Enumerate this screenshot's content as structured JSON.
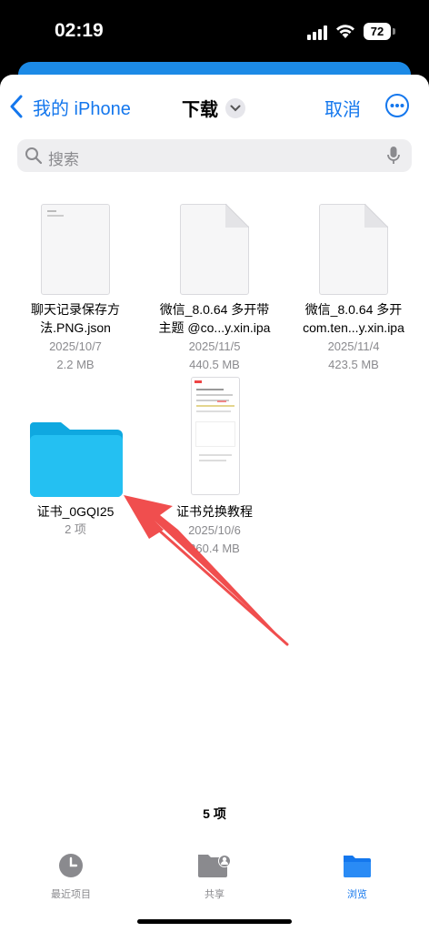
{
  "status_bar": {
    "time": "02:19",
    "battery": "72"
  },
  "nav": {
    "back_label": "我的 iPhone",
    "title": "下载",
    "cancel_label": "取消"
  },
  "search": {
    "placeholder": "搜索"
  },
  "files": [
    {
      "name_line1": "聊天记录保存方",
      "name_line2": "法.PNG.json",
      "date": "2025/10/7",
      "size": "2.2 MB"
    },
    {
      "name_line1": "微信_8.0.64 多开带",
      "name_line2": "主题 @co...y.xin.ipa",
      "date": "2025/11/5",
      "size": "440.5 MB"
    },
    {
      "name_line1": "微信_8.0.64 多开",
      "name_line2": "com.ten...y.xin.ipa",
      "date": "2025/11/4",
      "size": "423.5 MB"
    },
    {
      "name_line1": "证书_0GQI25",
      "name_line2": "",
      "date": "",
      "size": "2 项"
    },
    {
      "name_line1": "证书兑换教程",
      "name_line2": "",
      "date": "2025/10/6",
      "size": "360.4 MB"
    }
  ],
  "footer": {
    "count": "5 项"
  },
  "tabs": [
    {
      "label": "最近项目",
      "icon": "clock-icon"
    },
    {
      "label": "共享",
      "icon": "shared-folder-icon"
    },
    {
      "label": "浏览",
      "icon": "folder-icon"
    }
  ],
  "colors": {
    "accent": "#1477ed",
    "folder": "#1fb6ec",
    "arrow": "#f04e4e"
  }
}
